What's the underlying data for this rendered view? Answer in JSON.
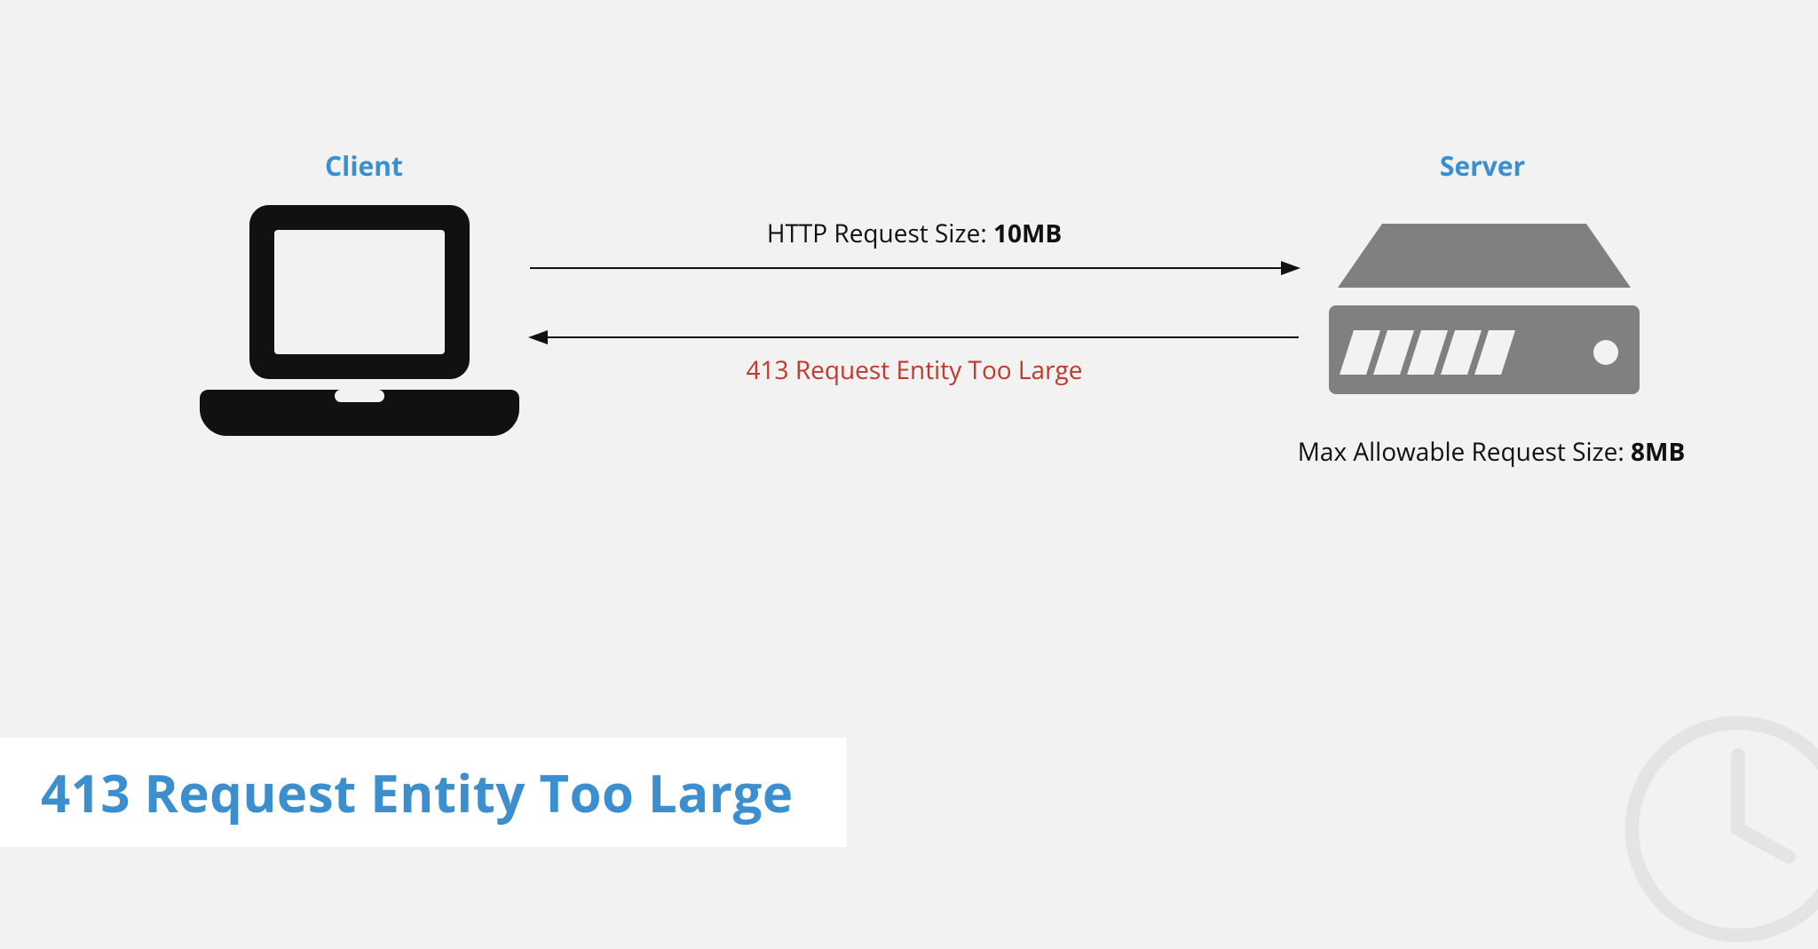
{
  "client": {
    "label": "Client"
  },
  "server": {
    "label": "Server"
  },
  "request": {
    "label_prefix": "HTTP Request Size: ",
    "size": "10MB"
  },
  "response": {
    "label": "413 Request Entity Too Large"
  },
  "server_caption": {
    "label_prefix": "Max Allowable Request Size: ",
    "size": "8MB"
  },
  "title": "413 Request Entity Too Large",
  "colors": {
    "blue": "#3b8fcf",
    "red": "#c0392b",
    "grey": "#808080",
    "bg": "#f2f2f2"
  }
}
